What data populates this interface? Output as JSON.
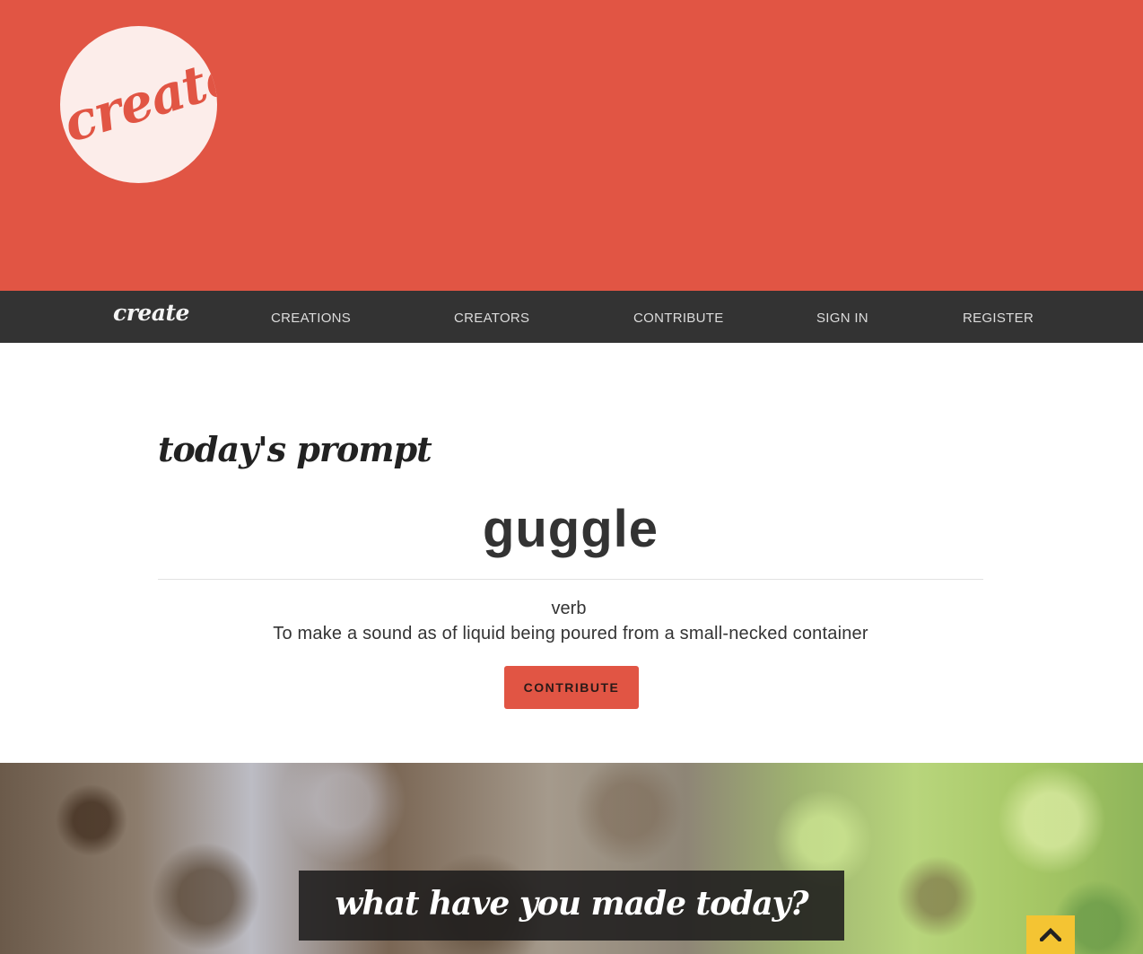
{
  "brand": {
    "logo_text": "create",
    "nav_brand": "create"
  },
  "nav": {
    "items": [
      {
        "label": "CREATIONS"
      },
      {
        "label": "CREATORS"
      },
      {
        "label": "CONTRIBUTE"
      },
      {
        "label": "SIGN IN"
      },
      {
        "label": "REGISTER"
      }
    ]
  },
  "prompt": {
    "heading": "today's prompt",
    "word": "guggle",
    "part_of_speech": "verb",
    "definition": "To make a sound as of liquid being poured from a small-necked container",
    "button_label": "CONTRIBUTE"
  },
  "banner": {
    "tagline": "what have you made today?"
  },
  "icons": {
    "scroll_top": "chevron-up-icon"
  },
  "colors": {
    "accent": "#e15544",
    "nav_bg": "#333333",
    "scroll_button": "#f4c433"
  }
}
